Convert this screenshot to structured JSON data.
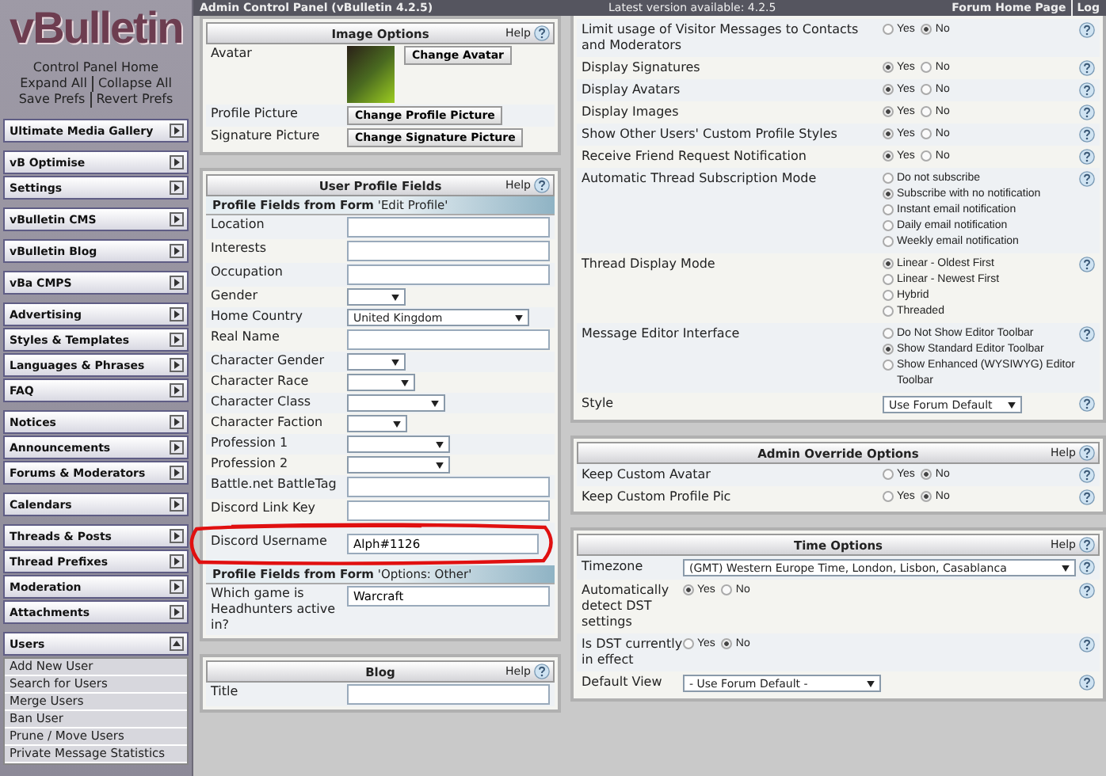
{
  "top_bar": {
    "title": "Admin Control Panel (vBulletin 4.2.5)",
    "version_note": "Latest version available: 4.2.5",
    "links": [
      "Forum Home Page",
      "Log"
    ]
  },
  "sidebar": {
    "logo": "vBulletin",
    "links": [
      [
        "Control Panel Home"
      ],
      [
        "Expand All",
        "Collapse All"
      ],
      [
        "Save Prefs",
        "Revert Prefs"
      ]
    ],
    "sections": [
      [
        {
          "label": "Ultimate Media Gallery",
          "expanded": false
        }
      ],
      [
        {
          "label": "vB Optimise",
          "expanded": false
        },
        {
          "label": "Settings",
          "expanded": false
        }
      ],
      [
        {
          "label": "vBulletin CMS",
          "expanded": false
        }
      ],
      [
        {
          "label": "vBulletin Blog",
          "expanded": false
        }
      ],
      [
        {
          "label": "vBa CMPS",
          "expanded": false
        }
      ],
      [
        {
          "label": "Advertising",
          "expanded": false
        },
        {
          "label": "Styles & Templates",
          "expanded": false
        },
        {
          "label": "Languages & Phrases",
          "expanded": false
        },
        {
          "label": "FAQ",
          "expanded": false
        }
      ],
      [
        {
          "label": "Notices",
          "expanded": false
        },
        {
          "label": "Announcements",
          "expanded": false
        },
        {
          "label": "Forums & Moderators",
          "expanded": false
        }
      ],
      [
        {
          "label": "Calendars",
          "expanded": false
        }
      ],
      [
        {
          "label": "Threads & Posts",
          "expanded": false
        },
        {
          "label": "Thread Prefixes",
          "expanded": false
        },
        {
          "label": "Moderation",
          "expanded": false
        },
        {
          "label": "Attachments",
          "expanded": false
        }
      ],
      [
        {
          "label": "Users",
          "expanded": true,
          "items": [
            "Add New User",
            "Search for Users",
            "Merge Users",
            "Ban User",
            "Prune / Move Users",
            "Private Message Statistics"
          ]
        }
      ]
    ]
  },
  "image_options": {
    "title": "Image Options",
    "help": "Help",
    "rows": [
      {
        "label": "Avatar",
        "kind": "avatar",
        "button": "Change Avatar"
      },
      {
        "label": "Profile Picture",
        "kind": "button",
        "button": "Change Profile Picture"
      },
      {
        "label": "Signature Picture",
        "kind": "button",
        "button": "Change Signature Picture"
      }
    ]
  },
  "profile_fields": {
    "title": "User Profile Fields",
    "help": "Help",
    "sections": [
      {
        "heading": "**Profile Fields from Form** 'Edit Profile'",
        "rows": [
          {
            "label": "Location",
            "kind": "text",
            "circled": false
          },
          {
            "label": "Interests",
            "kind": "text",
            "circled": false
          },
          {
            "label": "Occupation",
            "kind": "text",
            "circled": false
          },
          {
            "label": "Gender",
            "kind": "select",
            "circled": false
          },
          {
            "label": "Home Country",
            "kind": "select",
            "value": "United Kingdom",
            "circled": false
          },
          {
            "label": "Real Name",
            "kind": "text",
            "circled": false
          },
          {
            "label": "Character Gender",
            "kind": "select",
            "circled": false
          },
          {
            "label": "Character Race",
            "kind": "select",
            "circled": false
          },
          {
            "label": "Character Class",
            "kind": "select",
            "circled": false
          },
          {
            "label": "Character Faction",
            "kind": "select",
            "circled": false
          },
          {
            "label": "Profession 1",
            "kind": "select",
            "circled": false
          },
          {
            "label": "Profession 2",
            "kind": "select",
            "circled": false
          },
          {
            "label": "Battle.net BattleTag",
            "kind": "text",
            "circled": false
          },
          {
            "label": "Discord Link Key",
            "kind": "text",
            "circled": false
          },
          {
            "label": "Discord Username",
            "kind": "text",
            "value": "Alph#1126",
            "circled": true
          }
        ]
      },
      {
        "heading": "**Profile Fields from Form** 'Options: Other'",
        "rows": [
          {
            "label": "Which game is Headhunters active in?",
            "kind": "text",
            "value": "Warcraft"
          }
        ]
      }
    ]
  },
  "blog": {
    "title": "Blog",
    "help": "Help",
    "rows": [
      {
        "label": "Title",
        "kind": "text"
      }
    ]
  },
  "options": {
    "rows": [
      {
        "label": "Limit usage of Visitor Messages to Contacts and Moderators",
        "kind": "yesno",
        "options": [
          {
            "label": "Yes",
            "selected": false
          },
          {
            "label": "No",
            "selected": true
          }
        ]
      },
      {
        "label": "Display Signatures",
        "kind": "yesno",
        "options": [
          {
            "label": "Yes",
            "selected": true
          },
          {
            "label": "No",
            "selected": false
          }
        ]
      },
      {
        "label": "Display Avatars",
        "kind": "yesno",
        "options": [
          {
            "label": "Yes",
            "selected": true
          },
          {
            "label": "No",
            "selected": false
          }
        ]
      },
      {
        "label": "Display Images",
        "kind": "yesno",
        "options": [
          {
            "label": "Yes",
            "selected": true
          },
          {
            "label": "No",
            "selected": false
          }
        ]
      },
      {
        "label": "Show Other Users' Custom Profile Styles",
        "kind": "yesno",
        "options": [
          {
            "label": "Yes",
            "selected": true
          },
          {
            "label": "No",
            "selected": false
          }
        ]
      },
      {
        "label": "Receive Friend Request Notification",
        "kind": "yesno",
        "options": [
          {
            "label": "Yes",
            "selected": true
          },
          {
            "label": "No",
            "selected": false
          }
        ]
      },
      {
        "label": "Automatic Thread Subscription Mode",
        "kind": "choices",
        "options": [
          {
            "label": "Do not subscribe",
            "selected": false
          },
          {
            "label": "Subscribe with no notification",
            "selected": true
          },
          {
            "label": "Instant email notification",
            "selected": false
          },
          {
            "label": "Daily email notification",
            "selected": false
          },
          {
            "label": "Weekly email notification",
            "selected": false
          }
        ]
      },
      {
        "label": "Thread Display Mode",
        "kind": "choices",
        "options": [
          {
            "label": "Linear - Oldest First",
            "selected": true
          },
          {
            "label": "Linear - Newest First",
            "selected": false
          },
          {
            "label": "Hybrid",
            "selected": false
          },
          {
            "label": "Threaded",
            "selected": false
          }
        ]
      },
      {
        "label": "Message Editor Interface",
        "kind": "choices",
        "options": [
          {
            "label": "Do Not Show Editor Toolbar",
            "selected": false
          },
          {
            "label": "Show Standard Editor Toolbar",
            "selected": true
          },
          {
            "label": "Show Enhanced (WYSIWYG) Editor Toolbar",
            "selected": false
          }
        ]
      },
      {
        "label": "Style",
        "kind": "select",
        "value": "Use Forum Default"
      }
    ]
  },
  "admin_override": {
    "title": "Admin Override Options",
    "help": "Help",
    "rows": [
      {
        "label": "Keep Custom Avatar",
        "kind": "yesno",
        "options": [
          {
            "label": "Yes",
            "selected": false
          },
          {
            "label": "No",
            "selected": true
          }
        ]
      },
      {
        "label": "Keep Custom Profile Pic",
        "kind": "yesno",
        "options": [
          {
            "label": "Yes",
            "selected": false
          },
          {
            "label": "No",
            "selected": true
          }
        ]
      }
    ]
  },
  "time_options": {
    "title": "Time Options",
    "help": "Help",
    "rows": [
      {
        "label": "Timezone",
        "kind": "select",
        "value": "(GMT) Western Europe Time, London, Lisbon, Casablanca"
      },
      {
        "label": "Automatically detect DST settings",
        "kind": "yesno",
        "options": [
          {
            "label": "Yes",
            "selected": true
          },
          {
            "label": "No",
            "selected": false
          }
        ]
      },
      {
        "label": "Is DST currently in effect",
        "kind": "yesno",
        "options": [
          {
            "label": "Yes",
            "selected": false
          },
          {
            "label": "No",
            "selected": true
          }
        ]
      },
      {
        "label": "Default View",
        "kind": "select",
        "value": "- Use Forum Default -"
      }
    ]
  }
}
